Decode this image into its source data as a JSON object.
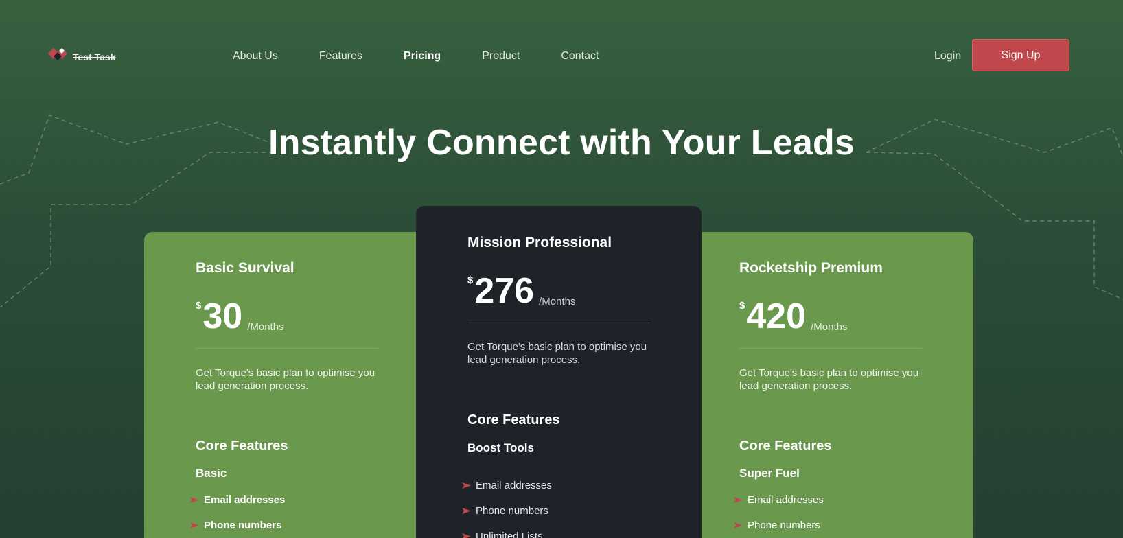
{
  "brand": {
    "name": "Test Task",
    "logo_colors": [
      "#c0474c",
      "#1e232a",
      "#ffffff"
    ]
  },
  "nav": {
    "items": [
      {
        "label": "About Us",
        "active": false
      },
      {
        "label": "Features",
        "active": false
      },
      {
        "label": "Pricing",
        "active": true
      },
      {
        "label": "Product",
        "active": false
      },
      {
        "label": "Contact",
        "active": false
      }
    ]
  },
  "auth": {
    "login_label": "Login",
    "signup_label": "Sign Up"
  },
  "hero": {
    "title": "Instantly Connect with Your Leads"
  },
  "plans": [
    {
      "name": "Basic Survival",
      "currency": "$",
      "amount": "30",
      "period": "/Months",
      "description": "Get Torque's basic plan to optimise you lead generation process.",
      "core_title": "Core Features",
      "tier": "Basic",
      "features": [
        "Email addresses",
        "Phone numbers"
      ]
    },
    {
      "name": "Mission Professional",
      "currency": "$",
      "amount": "276",
      "period": "/Months",
      "description": "Get Torque's basic plan to optimise you lead generation process.",
      "core_title": "Core Features",
      "tier": "Boost Tools",
      "features": [
        "Email addresses",
        "Phone numbers",
        "Unlimited Lists"
      ]
    },
    {
      "name": "Rocketship Premium",
      "currency": "$",
      "amount": "420",
      "period": "/Months",
      "description": "Get Torque's basic plan to optimise you lead generation process.",
      "core_title": "Core Features",
      "tier": "Super Fuel",
      "features": [
        "Email addresses",
        "Phone numbers"
      ]
    }
  ],
  "colors": {
    "background_top": "#37613f",
    "background_bottom": "#253f31",
    "card_green": "#6a994e",
    "card_dark": "#1e232a",
    "accent_red": "#c0474c"
  },
  "icons": {
    "logo": "diamond-logo-icon",
    "bullet": "arrow-right-icon"
  }
}
